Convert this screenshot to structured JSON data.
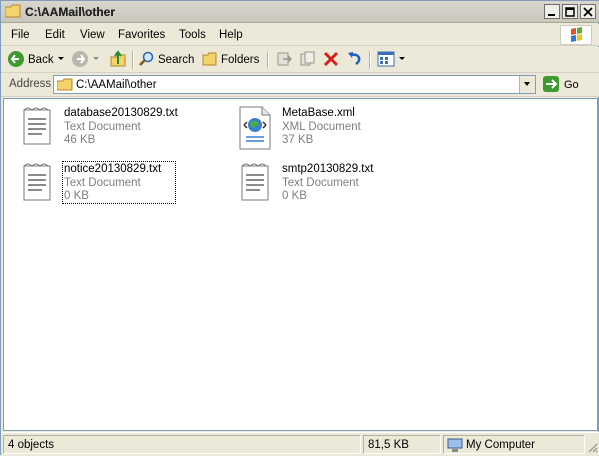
{
  "window": {
    "title": "C:\\AAMail\\other"
  },
  "menu": [
    {
      "label": "File"
    },
    {
      "label": "Edit"
    },
    {
      "label": "View"
    },
    {
      "label": "Favorites"
    },
    {
      "label": "Tools"
    },
    {
      "label": "Help"
    }
  ],
  "toolbar": {
    "back_label": "Back",
    "search_label": "Search",
    "folders_label": "Folders"
  },
  "address": {
    "label": "Address",
    "value": "C:\\AAMail\\other",
    "go_label": "Go"
  },
  "files": [
    {
      "name": "database20130829.txt",
      "type": "Text Document",
      "size": "46 KB",
      "icon": "text-file-icon"
    },
    {
      "name": "MetaBase.xml",
      "type": "XML Document",
      "size": "37 KB",
      "icon": "xml-file-icon"
    },
    {
      "name": "notice20130829.txt",
      "type": "Text Document",
      "size": "0 KB",
      "icon": "text-file-icon"
    },
    {
      "name": "smtp20130829.txt",
      "type": "Text Document",
      "size": "0 KB",
      "icon": "text-file-icon"
    }
  ],
  "status": {
    "objects": "4 objects",
    "size": "81,5 KB",
    "location": "My Computer"
  }
}
